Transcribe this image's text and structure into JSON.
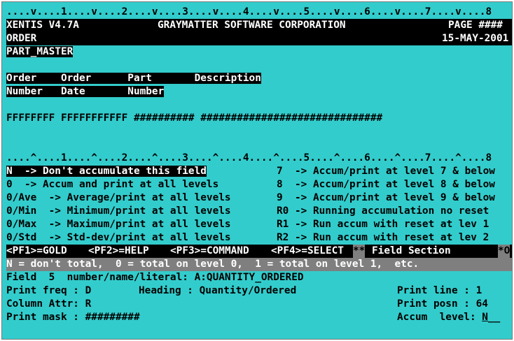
{
  "ruler_top": "....v....1....v....2....v....3....v....4....v....5....v....6....v....7....v....8",
  "header": {
    "product": "XENTIS V4.7A",
    "company": "GRAYMATTER SOFTWARE CORPORATION",
    "page_label": "PAGE ####",
    "report": "ORDER",
    "date": "15-MAY-2001",
    "table": "PART_MASTER"
  },
  "columns": {
    "line1": "Order    Order      Part       Description",
    "line2": "Number   Date       Number",
    "mask": "FFFFFFFF FFFFFFFFFFF ########## ##############################"
  },
  "ruler_bottom": "....^....1....^....2....^....3....^....4....^....5....^....6....^....7....^....8",
  "options_left": [
    "N  -> Don't accumulate this field",
    "0  -> Accum and print at all levels",
    "0/Ave  -> Average/print at all levels",
    "0/Min  -> Minimum/print at all levels",
    "0/Max  -> Maximum/print at all levels",
    "0/Std  -> Std-dev/print at all levels"
  ],
  "options_right": [
    "7  -> Accum/print at level 7 & below",
    "8  -> Accum/print at level 8 & below",
    "9  -> Accum/print at level 9 & below",
    "R0 -> Running accumulation no reset",
    "R1 -> Run accum with reset at lev 1",
    "R2 -> Run accum with reset at lev 2"
  ],
  "function_keys": {
    "pf1": "<PF1>=GOLD",
    "pf2": "<PF2>=HELP",
    "pf3": "<PF3>=COMMAND",
    "pf4": "<PF4>=SELECT",
    "stars": "**",
    "section": "Field Section",
    "end": "*O"
  },
  "help_line": "N = don't total,  0 = total on level 0,  1 = total on level 1,  etc.",
  "field": {
    "line": "Field  5  number/name/literal: A:QUANTITY_ORDERED",
    "print_freq": "Print freq : D",
    "heading": "Heading : Quantity/Ordered",
    "column_attr": "Column Attr: R",
    "print_mask": "Print mask : #########",
    "print_line": "Print line : 1",
    "print_posn": "Print posn : 64",
    "accum_label": "Accum  level: ",
    "accum_value": "N",
    "accum_blank": "__"
  }
}
